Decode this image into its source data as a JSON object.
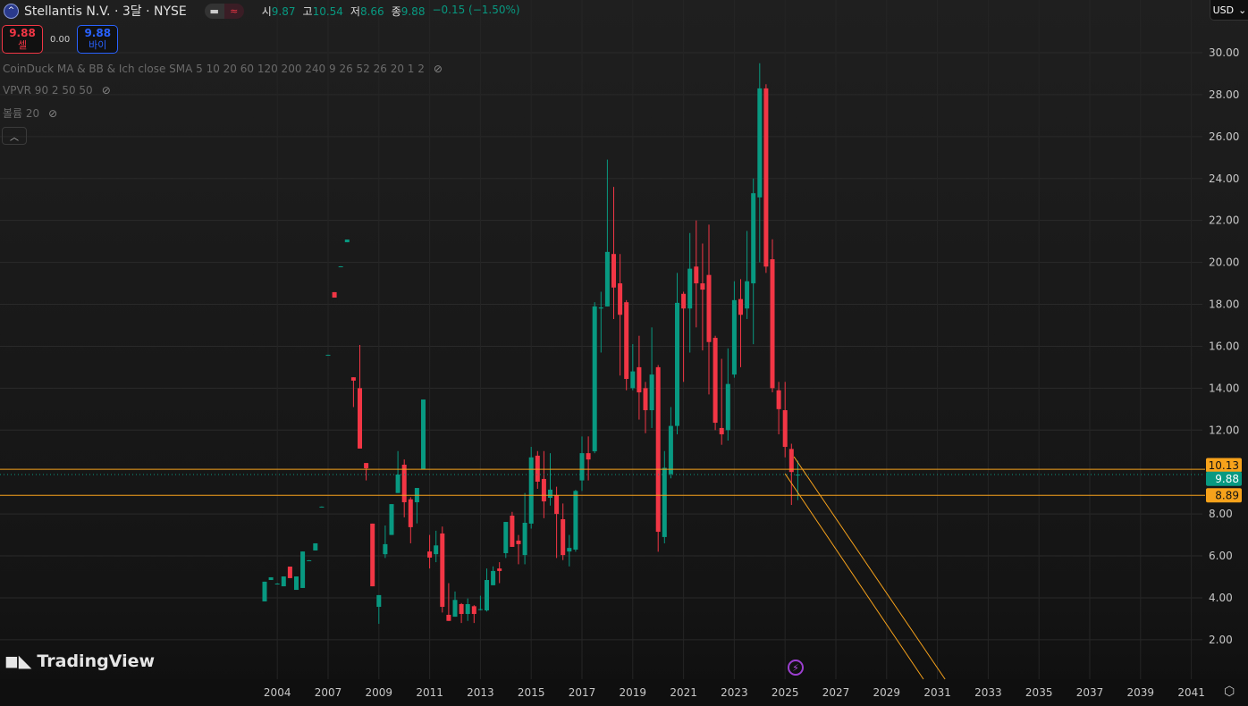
{
  "header": {
    "symbol": "Stellantis N.V. · 3달 · NYSE",
    "symbol_icon": "stellantis-logo",
    "ohlc": [
      {
        "k": "시",
        "v": "9.87"
      },
      {
        "k": "고",
        "v": "10.54"
      },
      {
        "k": "저",
        "v": "8.66"
      },
      {
        "k": "종",
        "v": "9.88"
      }
    ],
    "change": "−0.15 (−1.50%)"
  },
  "trade": {
    "sell_price": "9.88",
    "sell_label": "셀",
    "spread": "0.00",
    "buy_price": "9.88",
    "buy_label": "바이"
  },
  "indicators": [
    {
      "label": "CoinDuck MA & BB & Ich close SMA 5 10 20 60 120 200 240 9 26 52 26 20 1 2"
    },
    {
      "label": "VPVR 90 2 50 50"
    },
    {
      "label": "볼륨 20"
    }
  ],
  "currency": "USD",
  "brand": "TradingView",
  "colors": {
    "up": "#089981",
    "down": "#f23645",
    "line": "#f7a21b"
  },
  "chart_data": {
    "type": "candlestick",
    "interval": "3M",
    "ylim": [
      0,
      30.5
    ],
    "y_ticks": [
      "2.00",
      "4.00",
      "6.00",
      "8.00",
      "12.00",
      "14.00",
      "16.00",
      "18.00",
      "20.00",
      "22.00",
      "24.00",
      "26.00",
      "28.00",
      "30.00"
    ],
    "x_ticks": [
      {
        "label": "2004",
        "i": 2
      },
      {
        "label": "2007",
        "i": 10
      },
      {
        "label": "2009",
        "i": 18
      },
      {
        "label": "2011",
        "i": 26
      },
      {
        "label": "2013",
        "i": 34
      },
      {
        "label": "2015",
        "i": 42
      },
      {
        "label": "2017",
        "i": 50
      },
      {
        "label": "2019",
        "i": 58
      },
      {
        "label": "2021",
        "i": 66
      },
      {
        "label": "2023",
        "i": 74
      },
      {
        "label": "2025",
        "i": 82
      },
      {
        "label": "2027",
        "i": 90
      },
      {
        "label": "2029",
        "i": 98
      },
      {
        "label": "2031",
        "i": 106
      },
      {
        "label": "2033",
        "i": 114
      },
      {
        "label": "2035",
        "i": 122
      },
      {
        "label": "2037",
        "i": 130
      },
      {
        "label": "2039",
        "i": 138
      },
      {
        "label": "2041",
        "i": 146
      }
    ],
    "candles_ohlc": [
      [
        3.83,
        4.77,
        3.83,
        4.77
      ],
      [
        4.85,
        4.98,
        4.85,
        4.98
      ],
      [
        4.68,
        4.7,
        4.66,
        4.68
      ],
      [
        4.55,
        5.02,
        4.55,
        5.02
      ],
      [
        5.49,
        5.49,
        4.94,
        4.94
      ],
      [
        4.38,
        5.02,
        4.38,
        5.02
      ],
      [
        4.47,
        6.21,
        4.47,
        6.21
      ],
      [
        5.79,
        5.8,
        5.78,
        5.79
      ],
      [
        6.26,
        6.6,
        6.26,
        6.6
      ],
      [
        8.35,
        8.36,
        8.34,
        8.35
      ],
      [
        15.59,
        15.6,
        15.58,
        15.59
      ],
      [
        18.58,
        18.58,
        18.32,
        18.32
      ],
      [
        19.81,
        19.82,
        19.8,
        19.81
      ],
      [
        20.96,
        21.09,
        20.96,
        21.09
      ],
      [
        14.52,
        14.52,
        13.1,
        14.36
      ],
      [
        14.0,
        16.06,
        11.12,
        11.12
      ],
      [
        10.43,
        10.43,
        9.6,
        10.18
      ],
      [
        7.54,
        7.54,
        4.55,
        4.55
      ],
      [
        3.57,
        4.13,
        2.76,
        4.13
      ],
      [
        6.08,
        7.45,
        5.9,
        6.56
      ],
      [
        7.0,
        8.47,
        7.0,
        8.47
      ],
      [
        9.0,
        11.0,
        9.0,
        9.88
      ],
      [
        10.35,
        10.6,
        7.84,
        8.56
      ],
      [
        8.7,
        8.8,
        6.6,
        7.37
      ],
      [
        8.56,
        9.24,
        7.55,
        9.24
      ],
      [
        10.14,
        13.46,
        10.14,
        13.46
      ],
      [
        6.21,
        7.0,
        5.4,
        5.92
      ],
      [
        6.08,
        7.2,
        5.7,
        6.5
      ],
      [
        7.07,
        7.4,
        3.3,
        3.57
      ],
      [
        3.19,
        4.7,
        2.9,
        2.9
      ],
      [
        3.1,
        4.3,
        3.1,
        3.9
      ],
      [
        3.7,
        3.75,
        2.8,
        3.23
      ],
      [
        3.23,
        3.97,
        2.9,
        3.7
      ],
      [
        3.6,
        3.65,
        2.8,
        3.23
      ],
      [
        3.44,
        4.1,
        3.4,
        3.46
      ],
      [
        3.4,
        5.4,
        3.35,
        4.85
      ],
      [
        4.6,
        5.5,
        4.6,
        5.28
      ],
      [
        5.4,
        5.7,
        4.7,
        5.28
      ],
      [
        6.13,
        7.62,
        5.9,
        7.62
      ],
      [
        7.92,
        8.1,
        6.43,
        6.43
      ],
      [
        6.73,
        7.0,
        5.6,
        6.56
      ],
      [
        6.04,
        9.0,
        5.6,
        7.58
      ],
      [
        7.54,
        11.2,
        7.3,
        10.7
      ],
      [
        10.78,
        11.0,
        9.2,
        9.54
      ],
      [
        9.67,
        11.0,
        7.8,
        8.6
      ],
      [
        8.77,
        10.9,
        8.4,
        9.16
      ],
      [
        8.9,
        9.3,
        5.9,
        8.0
      ],
      [
        7.75,
        8.5,
        5.8,
        6.04
      ],
      [
        6.21,
        7.0,
        5.5,
        6.38
      ],
      [
        6.3,
        9.15,
        6.2,
        9.1
      ],
      [
        9.6,
        11.7,
        9.1,
        10.9
      ],
      [
        10.9,
        11.7,
        9.6,
        10.6
      ],
      [
        10.99,
        18.1,
        10.9,
        17.9
      ],
      [
        17.8,
        18.6,
        15.7,
        17.85
      ],
      [
        17.9,
        24.9,
        17.9,
        20.5
      ],
      [
        20.4,
        23.6,
        17.3,
        18.8
      ],
      [
        19.0,
        20.4,
        14.6,
        17.5
      ],
      [
        18.1,
        18.2,
        13.9,
        14.44
      ],
      [
        14.0,
        16.1,
        13.9,
        14.8
      ],
      [
        15.0,
        16.5,
        12.5,
        13.8
      ],
      [
        14.0,
        14.3,
        11.85,
        12.95
      ],
      [
        12.95,
        16.9,
        12.1,
        14.65
      ],
      [
        15.0,
        15.1,
        6.2,
        7.15
      ],
      [
        6.9,
        11.0,
        6.6,
        10.2
      ],
      [
        9.9,
        13.1,
        9.7,
        12.2
      ],
      [
        12.2,
        19.5,
        11.8,
        18.07
      ],
      [
        18.5,
        18.6,
        14.3,
        17.8
      ],
      [
        17.8,
        21.4,
        15.7,
        19.7
      ],
      [
        19.8,
        22.0,
        16.9,
        19.0
      ],
      [
        19.0,
        20.9,
        15.8,
        18.7
      ],
      [
        19.4,
        21.8,
        13.7,
        16.2
      ],
      [
        16.4,
        16.5,
        12.0,
        12.35
      ],
      [
        12.1,
        15.4,
        11.3,
        11.8
      ],
      [
        12.0,
        15.9,
        11.5,
        14.2
      ],
      [
        14.65,
        19.1,
        14.5,
        18.2
      ],
      [
        18.25,
        19.2,
        15.0,
        17.5
      ],
      [
        17.8,
        21.5,
        17.3,
        19.1
      ],
      [
        19.0,
        24.0,
        16.1,
        23.3
      ],
      [
        23.1,
        29.5,
        20.0,
        28.3
      ],
      [
        28.3,
        28.5,
        19.5,
        19.8
      ],
      [
        20.15,
        21.1,
        13.8,
        14.0
      ],
      [
        13.9,
        14.3,
        11.8,
        13.0
      ],
      [
        12.95,
        14.3,
        10.7,
        11.2
      ],
      [
        11.1,
        11.35,
        8.43,
        10.0
      ],
      [
        9.87,
        10.54,
        8.66,
        9.88
      ]
    ],
    "horizontal_lines": [
      {
        "price": 10.13,
        "label": "10.13"
      },
      {
        "price": 8.89,
        "label": "8.89"
      }
    ],
    "last_price": {
      "price": 9.88,
      "label": "9.88"
    },
    "trend_lines": [
      {
        "from": [
          82,
          9.92
        ],
        "to": [
          103.8,
          0.12
        ]
      },
      {
        "from": [
          83.4,
          10.73
        ],
        "to": [
          107.2,
          0.12
        ]
      }
    ]
  }
}
